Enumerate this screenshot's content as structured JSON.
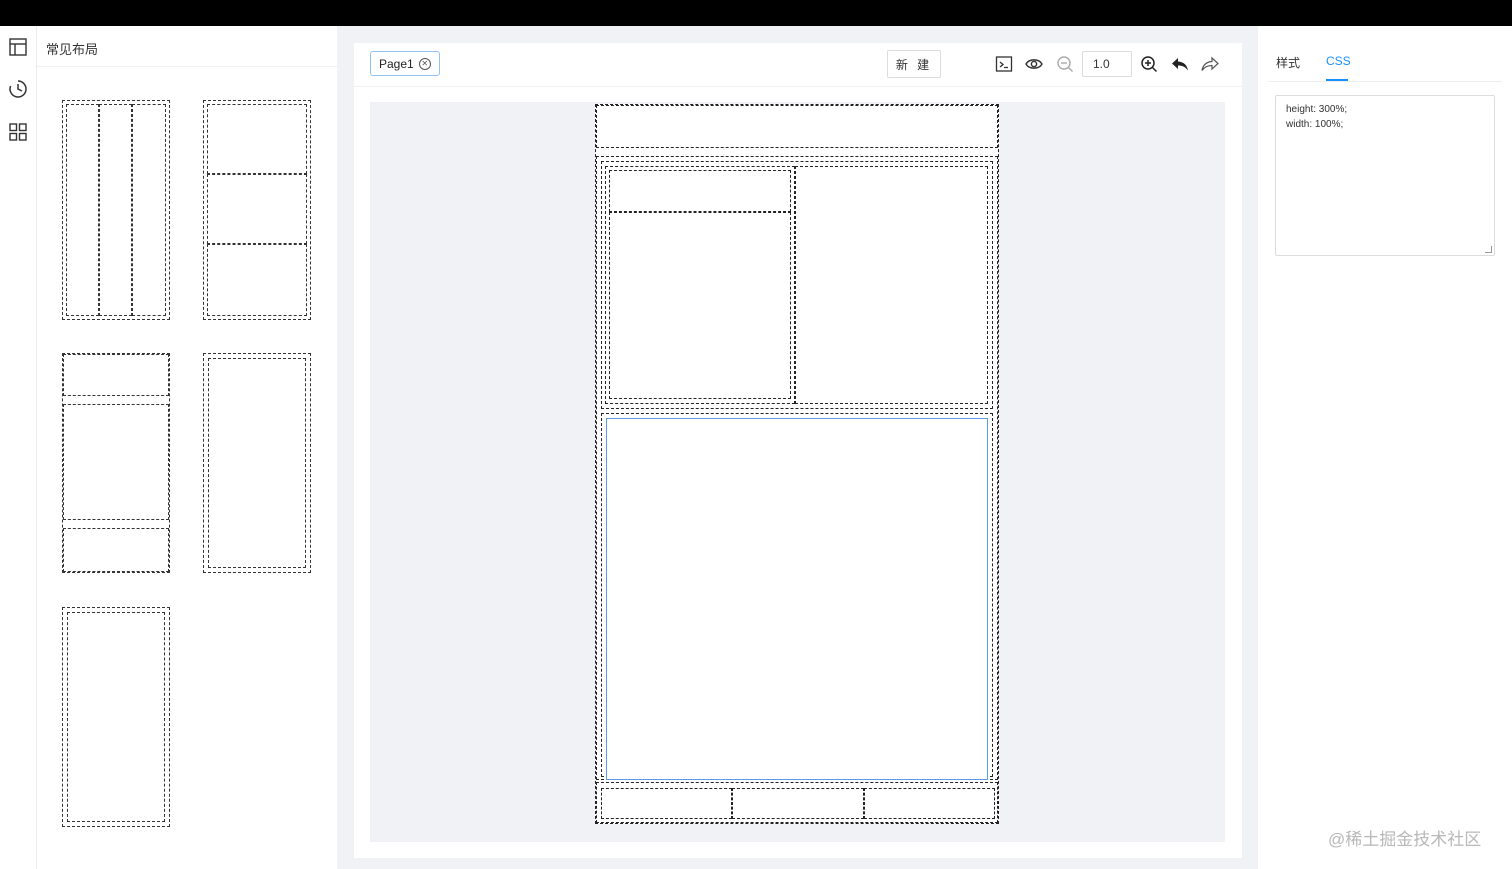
{
  "rail": {
    "items": [
      {
        "icon": "layout-icon"
      },
      {
        "icon": "history-icon"
      },
      {
        "icon": "grid-icon"
      }
    ]
  },
  "panel": {
    "title": "常见布局"
  },
  "toolbar": {
    "page_tab_label": "Page1",
    "new_label": "新 建",
    "zoom_value": "1.0"
  },
  "props": {
    "tabs": [
      {
        "label": "样式",
        "active": false
      },
      {
        "label": "CSS",
        "active": true
      }
    ],
    "css_lines": [
      "height: 300%;",
      "width: 100%;"
    ]
  },
  "watermark": "@稀土掘金技术社区",
  "colors": {
    "accent": "#1890ff",
    "canvas_bg": "#f0f2f5",
    "selected_border": "#5b9bea"
  }
}
